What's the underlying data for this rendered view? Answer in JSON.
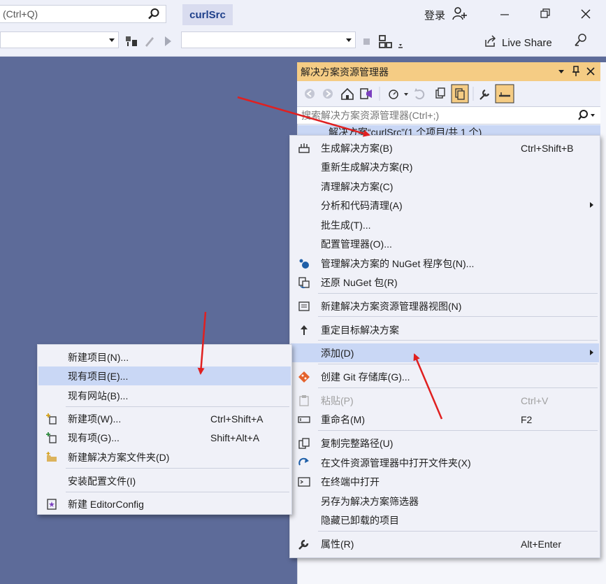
{
  "titlebar": {
    "search_text": "(Ctrl+Q)",
    "project_title": "curlSrc",
    "login": "登录"
  },
  "toolbar": {
    "live_share": "Live Share"
  },
  "solution_explorer": {
    "title": "解决方案资源管理器",
    "search_placeholder": "搜索解决方案资源管理器(Ctrl+;)",
    "tree_root": "解决方案“curlSrc”(1 个项目/共 1 个)"
  },
  "context_menu": {
    "items": [
      {
        "label": "生成解决方案(B)",
        "shortcut": "Ctrl+Shift+B",
        "icon": "build-icon"
      },
      {
        "label": "重新生成解决方案(R)",
        "shortcut": ""
      },
      {
        "label": "清理解决方案(C)",
        "shortcut": ""
      },
      {
        "label": "分析和代码清理(A)",
        "shortcut": "",
        "submenu": true
      },
      {
        "label": "批生成(T)...",
        "shortcut": ""
      },
      {
        "label": "配置管理器(O)...",
        "shortcut": ""
      },
      {
        "label": "管理解决方案的 NuGet 程序包(N)...",
        "shortcut": "",
        "icon": "nuget-icon"
      },
      {
        "label": "还原 NuGet 包(R)",
        "shortcut": "",
        "icon": "restore-icon"
      },
      {
        "label": "新建解决方案资源管理器视图(N)",
        "shortcut": "",
        "icon": "new-view-icon"
      },
      {
        "label": "重定目标解决方案",
        "shortcut": "",
        "icon": "up-arrow-icon"
      },
      {
        "label": "添加(D)",
        "shortcut": "",
        "submenu": true
      },
      {
        "label": "创建 Git 存储库(G)...",
        "shortcut": "",
        "icon": "git-icon"
      },
      {
        "label": "粘贴(P)",
        "shortcut": "Ctrl+V",
        "icon": "paste-icon"
      },
      {
        "label": "重命名(M)",
        "shortcut": "F2",
        "icon": "rename-icon"
      },
      {
        "label": "复制完整路径(U)",
        "shortcut": "",
        "icon": "copy-icon"
      },
      {
        "label": "在文件资源管理器中打开文件夹(X)",
        "shortcut": "",
        "icon": "open-folder-icon"
      },
      {
        "label": "在终端中打开",
        "shortcut": "",
        "icon": "terminal-icon"
      },
      {
        "label": "另存为解决方案筛选器",
        "shortcut": ""
      },
      {
        "label": "隐藏已卸载的项目",
        "shortcut": ""
      },
      {
        "label": "属性(R)",
        "shortcut": "Alt+Enter",
        "icon": "wrench-icon"
      }
    ]
  },
  "add_submenu": {
    "items": [
      {
        "label": "新建项目(N)...",
        "shortcut": ""
      },
      {
        "label": "现有项目(E)...",
        "shortcut": ""
      },
      {
        "label": "现有网站(B)...",
        "shortcut": ""
      },
      {
        "label": "新建项(W)...",
        "shortcut": "Ctrl+Shift+A",
        "icon": "new-item-icon"
      },
      {
        "label": "现有项(G)...",
        "shortcut": "Shift+Alt+A",
        "icon": "existing-item-icon"
      },
      {
        "label": "新建解决方案文件夹(D)",
        "shortcut": "",
        "icon": "new-folder-icon"
      },
      {
        "label": "安装配置文件(I)",
        "shortcut": ""
      },
      {
        "label": "新建 EditorConfig",
        "shortcut": "",
        "icon": "editorconfig-icon"
      }
    ]
  },
  "colors": {
    "background": "#5d6b99",
    "highlight": "#c9d7f5",
    "panel_header": "#f5cc84",
    "annotation_arrow": "#e02020"
  }
}
